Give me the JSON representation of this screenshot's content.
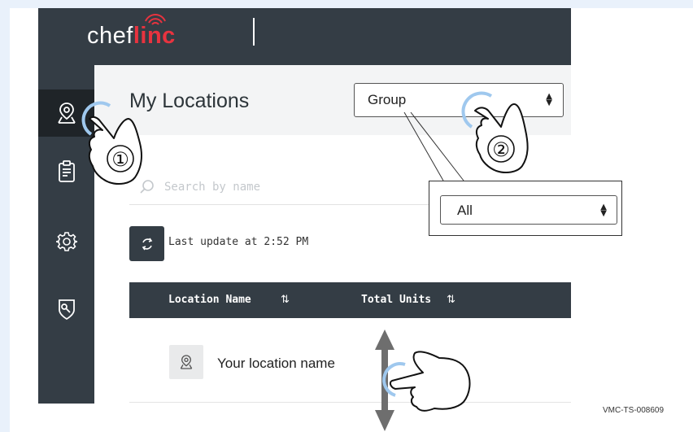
{
  "app": {
    "logo_chef": "chef",
    "logo_linc": "linc"
  },
  "sidebar": {
    "items": [
      {
        "name": "locations",
        "icon": "location-pin-icon",
        "active": true
      },
      {
        "name": "reports",
        "icon": "clipboard-icon",
        "active": false
      },
      {
        "name": "settings",
        "icon": "gear-icon",
        "active": false
      },
      {
        "name": "service",
        "icon": "wrench-shield-icon",
        "active": false
      }
    ]
  },
  "main": {
    "title": "My Locations",
    "group_select": {
      "value": "Group"
    },
    "search": {
      "placeholder": "Search by name"
    },
    "last_update": "Last update at 2:52 PM",
    "table": {
      "columns": [
        {
          "label": "Location Name",
          "sort_icon": "sort-arrows-icon"
        },
        {
          "label": "Total Units",
          "sort_icon": "sort-arrows-icon"
        }
      ],
      "rows": [
        {
          "name": "Your location name",
          "icon": "location-pin-icon"
        }
      ]
    }
  },
  "callout": {
    "select_value": "All"
  },
  "annotations": {
    "step_1": "①",
    "step_2": "②",
    "scroll_gesture": "vertical-swipe"
  },
  "doc_code": "VMC-TS-008609",
  "colors": {
    "header_bg": "#343d45",
    "accent_red": "#e8333f",
    "active_item": "#1f2428",
    "touch_ring": "#9fc8ee"
  }
}
